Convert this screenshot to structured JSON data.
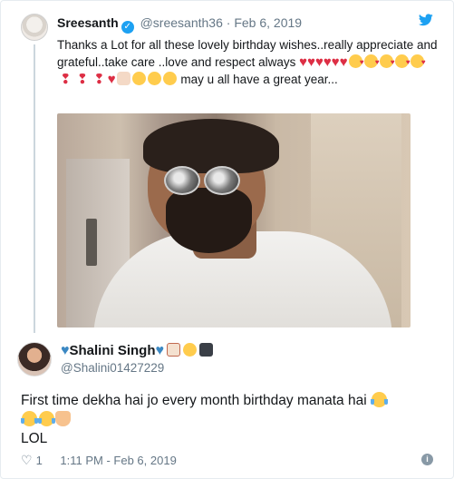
{
  "quoted_tweet": {
    "author_name": "Sreesanth",
    "handle": "@sreesanth36",
    "separator": "·",
    "date": "Feb 6, 2019",
    "text_line1": "Thanks a Lot for all these lovely birthday wishes..really appreciate and grateful..take care ..love and respect always",
    "text_tail": "may u all have a great year...",
    "emoji_sequence": [
      "red-heart",
      "red-heart",
      "red-heart",
      "red-heart",
      "red-heart",
      "red-heart",
      "kiss-face",
      "kiss-face",
      "kiss-face",
      "kiss-face",
      "kiss-face",
      "heart-exclamation",
      "heart-exclamation",
      "heart-exclamation",
      "red-heart",
      "thumbs-up",
      "hug-face",
      "hug-face",
      "hug-face"
    ],
    "photo_alt_icon": "selfie-photo"
  },
  "reply_tweet": {
    "display_name": "Shalini Singh",
    "name_emojis": [
      "blue-heart",
      "blue-heart",
      "bow-and-arrow",
      "baby-chick",
      "detective"
    ],
    "handle": "@Shalini01427229",
    "text_main": "First time dekha hai jo every month birthday manata hai",
    "text_lol": "LOL",
    "like_count": "1",
    "timestamp": "1:11 PM - Feb 6, 2019"
  },
  "colors": {
    "text": "#14171a",
    "muted": "#657786",
    "twitter_blue": "#1da1f2",
    "heart_red": "#dd2e44",
    "blue_heart": "#3b88c3"
  }
}
